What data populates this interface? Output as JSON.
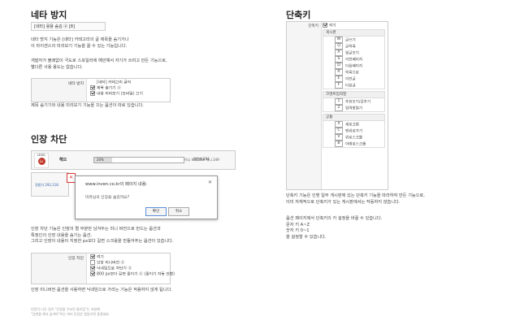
{
  "left": {
    "section1": {
      "title": "네타 방지",
      "sample_text": "[네타] 용용 숨김 ⓟ [8]",
      "desc1": "네타 방지 기능은 [네타] 카테고리의 글 제목을 숨기거나\n이 라이센스의 미리보기 기능을 끌 수 있는 기능입니다.",
      "desc2": "개발자가 불쾌없이 극도로 스포일러에 예민해서 자기가 쓰려고 만든 기능으로,\n별다른 사용 용도는 없습니다.",
      "option_label": "네타 방지",
      "options": [
        {
          "label": "[네타] 카테고리 글의",
          "checked": false
        },
        {
          "label": "제목 숨기기 ⓟ",
          "checked": true
        },
        {
          "label": "내용 미리보기 (모바일) 끄기",
          "checked": true
        }
      ],
      "desc3": "제목 숨기기와 내용 미리보기 기능을 끄는 옵션이 따로 있습니다."
    },
    "section2": {
      "title": "인장 차단",
      "bar": {
        "level": "LEVEL",
        "badge": "Lv",
        "name": "헤으",
        "percent": "20%",
        "stat1": "이니 460,886",
        "stat2": "헤니 249",
        "stat3": "경험치 291"
      },
      "sig_label": "경험치 292,118",
      "dialog": {
        "title": "www.inven.co.kr의 페이지 내용:",
        "message": "미유님의 인장을 숨길까요?",
        "ok": "확인",
        "cancel": "취소"
      },
      "desc1": "인장 차단 기능은 인장의 짤 부분만 남겨두는 미니 버전으로 만드는 옵션과\n특정인의 인장 내용을 숨기는 옵션,\n그리고 인장이 내용이 지정한 px보다 길면 스크롤을 만들어주는 옵션이 있습니다.",
      "option_label": "인장 차단",
      "options": [
        {
          "label": "켜기",
          "checked": true
        },
        {
          "label": "인장 미니버전 ⓟ",
          "checked": false
        },
        {
          "label": "닉네임으로 차단기 ⓟ",
          "checked": true
        },
        {
          "label": "800 px보다 길면 줄이기 ⓟ (줄이기 자동 안함)",
          "checked": true
        }
      ],
      "desc2": "인장 미니버전 옵션을 사용하면 닉네임으로 가리는 기능은 적용하지 않게 됩니다.",
      "footnote": "인장이 너무 길어 \"인장을 꾸코린 클리밍\"는 요청해\n\"답변을 해서 숨겨야\"하는 여러 인장은 알았으면 좋겠네요."
    }
  },
  "right": {
    "title": "단축키",
    "label": "단축키",
    "enable": "켜기",
    "groups": [
      {
        "name": "게시판",
        "items": [
          {
            "key": "W",
            "label": "글쓰기"
          },
          {
            "key": "Q",
            "label": "글목록"
          },
          {
            "key": "A",
            "label": "윗글보기"
          },
          {
            "key": "S",
            "label": "이전페이지"
          },
          {
            "key": "D",
            "label": "다음페이지"
          },
          {
            "key": "R",
            "label": "목록으로"
          },
          {
            "key": "E",
            "label": "이전글"
          },
          {
            "key": "F",
            "label": "다음글"
          }
        ]
      },
      {
        "name": "코멘트입력창",
        "items": [
          {
            "key": "1",
            "label": "추천보기/감추기"
          },
          {
            "key": "2",
            "label": "입력창열기"
          }
        ]
      },
      {
        "name": "공통",
        "items": [
          {
            "key": "X",
            "label": "새로고침"
          },
          {
            "key": "C",
            "label": "맨위로가기"
          },
          {
            "key": "V",
            "label": "위로스크롤"
          },
          {
            "key": "B",
            "label": "아래로스크롤"
          }
        ]
      }
    ],
    "desc1": "단축키 기능은 인벤 일부 게시판에 있는 단축키 기능을 따라하여 만든 기능으로,\n이미 자체적으로 단축키가 있는 게시판에서는 작동하지 않습니다.",
    "desc2": "옵션 페이지에서 단축키의 키 설정을 바꿀 수 있습니다.\n문자 키 A~Z\n숫자 키 0~1\n을 설정할 수 있습니다."
  }
}
